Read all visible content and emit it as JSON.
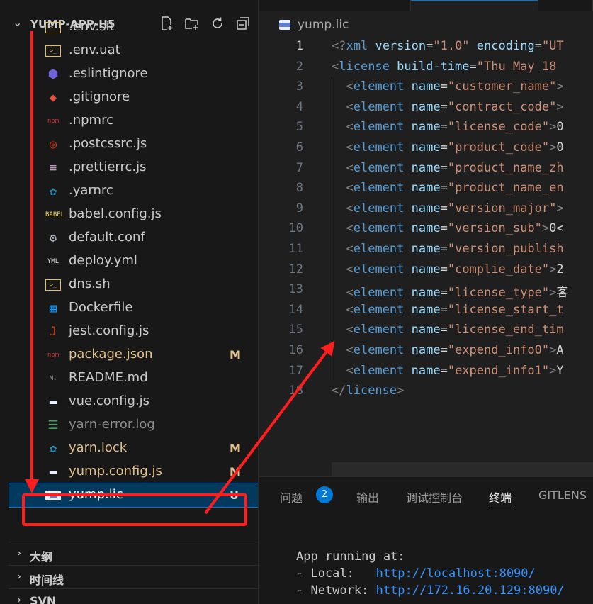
{
  "explorer": {
    "title": "YUMP-APP-H5",
    "actions": [
      "new-file-icon",
      "new-folder-icon",
      "refresh-icon",
      "collapse-all-icon"
    ],
    "files": [
      {
        "name": ".env.sit",
        "icon": "terminal-file-icon",
        "status": ""
      },
      {
        "name": ".env.uat",
        "icon": "terminal-file-icon",
        "status": ""
      },
      {
        "name": ".eslintignore",
        "icon": "eslint-icon",
        "status": ""
      },
      {
        "name": ".gitignore",
        "icon": "git-icon",
        "status": ""
      },
      {
        "name": ".npmrc",
        "icon": "npm-icon",
        "status": ""
      },
      {
        "name": ".postcssrc.js",
        "icon": "postcss-icon",
        "status": ""
      },
      {
        "name": ".prettierrc.js",
        "icon": "prettier-icon",
        "status": ""
      },
      {
        "name": ".yarnrc",
        "icon": "yarn-icon",
        "status": ""
      },
      {
        "name": "babel.config.js",
        "icon": "babel-icon",
        "status": ""
      },
      {
        "name": "default.conf",
        "icon": "gear-icon",
        "status": ""
      },
      {
        "name": "deploy.yml",
        "icon": "yaml-icon",
        "status": ""
      },
      {
        "name": "dns.sh",
        "icon": "terminal-file-icon",
        "status": ""
      },
      {
        "name": "Dockerfile",
        "icon": "docker-icon",
        "status": ""
      },
      {
        "name": "jest.config.js",
        "icon": "jest-icon",
        "status": ""
      },
      {
        "name": "package.json",
        "icon": "npm-icon",
        "status": "M"
      },
      {
        "name": "README.md",
        "icon": "markdown-icon",
        "status": ""
      },
      {
        "name": "vue.config.js",
        "icon": "config-file-icon",
        "status": ""
      },
      {
        "name": "yarn-error.log",
        "icon": "log-file-icon",
        "status": ""
      },
      {
        "name": "yarn.lock",
        "icon": "yarn-icon",
        "status": "M"
      },
      {
        "name": "yump.config.js",
        "icon": "config-file-icon",
        "status": "M"
      },
      {
        "name": "yump.lic",
        "icon": "xml-file-icon",
        "status": "U"
      }
    ],
    "sections": [
      {
        "label": "大纲"
      },
      {
        "label": "时间线"
      },
      {
        "label": "SVN"
      }
    ]
  },
  "editor": {
    "breadcrumb": "yump.lic",
    "lines": [
      {
        "num": "1",
        "tokens": [
          [
            "pun",
            "<?"
          ],
          [
            "tag",
            "xml"
          ],
          [
            "txt",
            " "
          ],
          [
            "attr",
            "version"
          ],
          [
            "txt",
            "="
          ],
          [
            "str",
            "\"1.0\""
          ],
          [
            "txt",
            " "
          ],
          [
            "attr",
            "encoding"
          ],
          [
            "txt",
            "="
          ],
          [
            "str",
            "\"UT"
          ]
        ]
      },
      {
        "num": "2",
        "tokens": [
          [
            "pun",
            "<"
          ],
          [
            "tag",
            "license"
          ],
          [
            "txt",
            " "
          ],
          [
            "attr",
            "build-time"
          ],
          [
            "txt",
            "="
          ],
          [
            "str",
            "\"Thu May 18"
          ]
        ]
      },
      {
        "num": "3",
        "tokens": [
          [
            "txt",
            "  "
          ],
          [
            "pun",
            "<"
          ],
          [
            "tag",
            "element"
          ],
          [
            "txt",
            " "
          ],
          [
            "attr",
            "name"
          ],
          [
            "txt",
            "="
          ],
          [
            "str",
            "\"customer_name\""
          ],
          [
            "pun",
            ">"
          ]
        ]
      },
      {
        "num": "4",
        "tokens": [
          [
            "txt",
            "  "
          ],
          [
            "pun",
            "<"
          ],
          [
            "tag",
            "element"
          ],
          [
            "txt",
            " "
          ],
          [
            "attr",
            "name"
          ],
          [
            "txt",
            "="
          ],
          [
            "str",
            "\"contract_code\""
          ],
          [
            "pun",
            ">"
          ]
        ]
      },
      {
        "num": "5",
        "tokens": [
          [
            "txt",
            "  "
          ],
          [
            "pun",
            "<"
          ],
          [
            "tag",
            "element"
          ],
          [
            "txt",
            " "
          ],
          [
            "attr",
            "name"
          ],
          [
            "txt",
            "="
          ],
          [
            "str",
            "\"license_code\""
          ],
          [
            "pun",
            ">"
          ],
          [
            "txt",
            "0"
          ]
        ]
      },
      {
        "num": "6",
        "tokens": [
          [
            "txt",
            "  "
          ],
          [
            "pun",
            "<"
          ],
          [
            "tag",
            "element"
          ],
          [
            "txt",
            " "
          ],
          [
            "attr",
            "name"
          ],
          [
            "txt",
            "="
          ],
          [
            "str",
            "\"product_code\""
          ],
          [
            "pun",
            ">"
          ],
          [
            "txt",
            "0"
          ]
        ]
      },
      {
        "num": "7",
        "tokens": [
          [
            "txt",
            "  "
          ],
          [
            "pun",
            "<"
          ],
          [
            "tag",
            "element"
          ],
          [
            "txt",
            " "
          ],
          [
            "attr",
            "name"
          ],
          [
            "txt",
            "="
          ],
          [
            "str",
            "\"product_name_zh"
          ]
        ]
      },
      {
        "num": "8",
        "tokens": [
          [
            "txt",
            "  "
          ],
          [
            "pun",
            "<"
          ],
          [
            "tag",
            "element"
          ],
          [
            "txt",
            " "
          ],
          [
            "attr",
            "name"
          ],
          [
            "txt",
            "="
          ],
          [
            "str",
            "\"product_name_en"
          ]
        ]
      },
      {
        "num": "9",
        "tokens": [
          [
            "txt",
            "  "
          ],
          [
            "pun",
            "<"
          ],
          [
            "tag",
            "element"
          ],
          [
            "txt",
            " "
          ],
          [
            "attr",
            "name"
          ],
          [
            "txt",
            "="
          ],
          [
            "str",
            "\"version_major\""
          ],
          [
            "pun",
            ">"
          ]
        ]
      },
      {
        "num": "10",
        "tokens": [
          [
            "txt",
            "  "
          ],
          [
            "pun",
            "<"
          ],
          [
            "tag",
            "element"
          ],
          [
            "txt",
            " "
          ],
          [
            "attr",
            "name"
          ],
          [
            "txt",
            "="
          ],
          [
            "str",
            "\"version_sub\""
          ],
          [
            "pun",
            ">"
          ],
          [
            "txt",
            "0<"
          ]
        ]
      },
      {
        "num": "11",
        "tokens": [
          [
            "txt",
            "  "
          ],
          [
            "pun",
            "<"
          ],
          [
            "tag",
            "element"
          ],
          [
            "txt",
            " "
          ],
          [
            "attr",
            "name"
          ],
          [
            "txt",
            "="
          ],
          [
            "str",
            "\"version_publish"
          ]
        ]
      },
      {
        "num": "12",
        "tokens": [
          [
            "txt",
            "  "
          ],
          [
            "pun",
            "<"
          ],
          [
            "tag",
            "element"
          ],
          [
            "txt",
            " "
          ],
          [
            "attr",
            "name"
          ],
          [
            "txt",
            "="
          ],
          [
            "str",
            "\"complie_date\""
          ],
          [
            "pun",
            ">"
          ],
          [
            "txt",
            "2"
          ]
        ]
      },
      {
        "num": "13",
        "tokens": [
          [
            "txt",
            "  "
          ],
          [
            "pun",
            "<"
          ],
          [
            "tag",
            "element"
          ],
          [
            "txt",
            " "
          ],
          [
            "attr",
            "name"
          ],
          [
            "txt",
            "="
          ],
          [
            "str",
            "\"license_type\""
          ],
          [
            "pun",
            ">"
          ],
          [
            "txt",
            "客"
          ]
        ]
      },
      {
        "num": "14",
        "tokens": [
          [
            "txt",
            "  "
          ],
          [
            "pun",
            "<"
          ],
          [
            "tag",
            "element"
          ],
          [
            "txt",
            " "
          ],
          [
            "attr",
            "name"
          ],
          [
            "txt",
            "="
          ],
          [
            "str",
            "\"license_start_t"
          ]
        ]
      },
      {
        "num": "15",
        "tokens": [
          [
            "txt",
            "  "
          ],
          [
            "pun",
            "<"
          ],
          [
            "tag",
            "element"
          ],
          [
            "txt",
            " "
          ],
          [
            "attr",
            "name"
          ],
          [
            "txt",
            "="
          ],
          [
            "str",
            "\"license_end_tim"
          ]
        ]
      },
      {
        "num": "16",
        "tokens": [
          [
            "txt",
            "  "
          ],
          [
            "pun",
            "<"
          ],
          [
            "tag",
            "element"
          ],
          [
            "txt",
            " "
          ],
          [
            "attr",
            "name"
          ],
          [
            "txt",
            "="
          ],
          [
            "str",
            "\"expend_info0\""
          ],
          [
            "pun",
            ">"
          ],
          [
            "txt",
            "A"
          ]
        ]
      },
      {
        "num": "17",
        "tokens": [
          [
            "txt",
            "  "
          ],
          [
            "pun",
            "<"
          ],
          [
            "tag",
            "element"
          ],
          [
            "txt",
            " "
          ],
          [
            "attr",
            "name"
          ],
          [
            "txt",
            "="
          ],
          [
            "str",
            "\"expend_info1\""
          ],
          [
            "pun",
            ">"
          ],
          [
            "txt",
            "Y"
          ]
        ]
      },
      {
        "num": "18",
        "tokens": [
          [
            "pun",
            "</"
          ],
          [
            "tag",
            "license"
          ],
          [
            "pun",
            ">"
          ]
        ]
      }
    ]
  },
  "panel": {
    "tabs": [
      {
        "label": "问题"
      },
      {
        "label": "输出"
      },
      {
        "label": "调试控制台"
      },
      {
        "label": "终端"
      },
      {
        "label": "GITLENS"
      }
    ],
    "problems_count": "2",
    "terminal": {
      "line1": "App running at:",
      "local_label": "- Local:   ",
      "local_url": "http://localhost:8090/",
      "network_label": "- Network: ",
      "network_url": "http://172.16.20.129:8090/"
    }
  },
  "colors": {
    "modified": "#e2c08d",
    "annotation": "#ff1e1e",
    "accent": "#0078d4"
  }
}
